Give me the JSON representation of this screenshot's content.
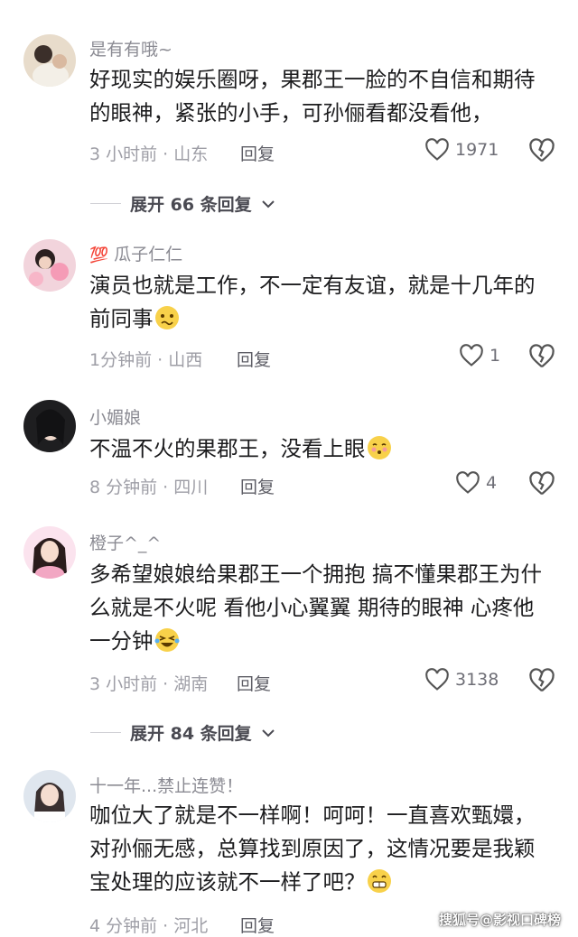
{
  "comments": [
    {
      "username": "是有有哦~",
      "badge": "",
      "text": "好现实的娱乐圈呀，果郡王一脸的不自信和期待的眼神，紧张的小手，可孙俪看都没看他，",
      "time_location": "3 小时前 · 山东",
      "reply_label": "回复",
      "likes": "1971",
      "expand_label": "展开 66 条回复"
    },
    {
      "username": "瓜子仁仁",
      "badge": "💯",
      "text": "演员也就是工作，不一定有友谊，就是十几年的前同事",
      "emoji": "confused-face-emoji",
      "time_location": "1分钟前 · 山西",
      "reply_label": "回复",
      "likes": "1"
    },
    {
      "username": "小媚娘",
      "badge": "",
      "text": "不温不火的果郡王，没看上眼",
      "emoji": "kiss-face-emoji",
      "time_location": "8 分钟前 · 四川",
      "reply_label": "回复",
      "likes": "4"
    },
    {
      "username": "橙子^_^",
      "badge": "",
      "text": "多希望娘娘给果郡王一个拥抱  搞不懂果郡王为什么就是不火呢 看他小心翼翼 期待的眼神 心疼他一分钟",
      "emoji": "rolling-laughing-emoji",
      "time_location": "3 小时前 · 湖南",
      "reply_label": "回复",
      "likes": "3138",
      "expand_label": "展开 84 条回复"
    },
    {
      "username": "十一年...禁止连赞！",
      "badge": "",
      "text": "咖位大了就是不一样啊！呵呵！一直喜欢甄嬛，对孙俪无感，总算找到原因了，这情况要是我颖宝处理的应该就不一样了吧？",
      "emoji": "grinning-face-emoji",
      "time_location": "4 分钟前 · 河北",
      "reply_label": "回复"
    }
  ],
  "watermark": "搜狐号@影视口碑榜",
  "colors": {
    "username": "#8b8b93",
    "text": "#1c1c1e",
    "meta": "#9e9ea6",
    "badge": "#e53935"
  }
}
